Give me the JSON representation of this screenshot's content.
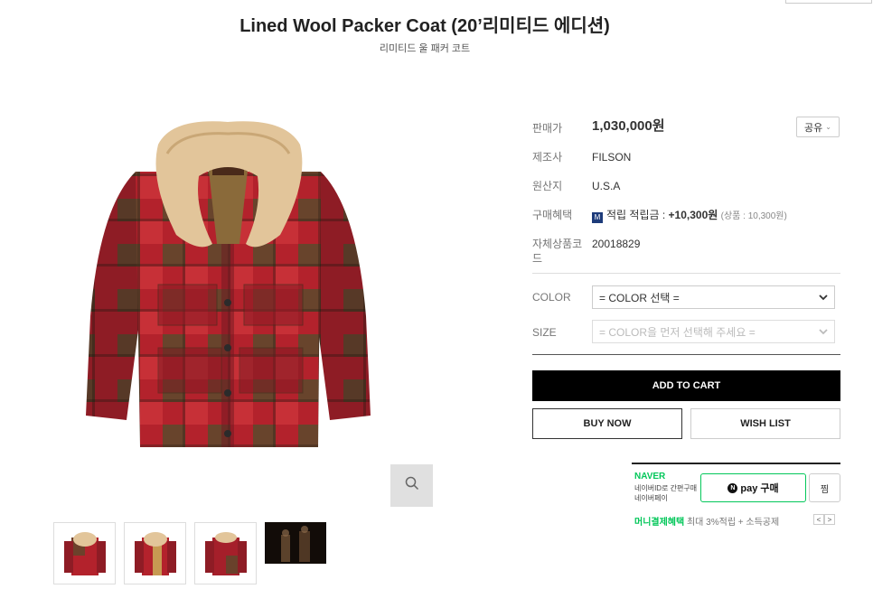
{
  "product": {
    "title": "Lined Wool Packer Coat (20’리미티드 에디션)",
    "subtitle": "리미티드 울 패커 코트"
  },
  "info": {
    "price_label": "판매가",
    "price_value": "1,030,000원",
    "share_label": "공유",
    "maker_label": "제조사",
    "maker_value": "FILSON",
    "origin_label": "원산지",
    "origin_value": "U.S.A",
    "benefit_label": "구매혜택",
    "benefit_badge": "M",
    "benefit_text": "적립 적립금 :",
    "benefit_amount": "+10,300원",
    "benefit_detail": "(상품 : 10,300원)",
    "code_label": "자체상품코드",
    "code_value": "20018829"
  },
  "options": {
    "color_label": "COLOR",
    "color_value": "= COLOR 선택 =",
    "size_label": "SIZE",
    "size_value": "= COLOR을 먼저 선택해 주세요 ="
  },
  "buttons": {
    "add_to_cart": "ADD TO CART",
    "buy_now": "BUY NOW",
    "wish_list": "WISH LIST"
  },
  "naver": {
    "logo": "NAVER",
    "desc_line1": "네이버ID로 간편구매",
    "desc_line2": "네이버페이",
    "pay_label": "pay 구매",
    "pay_n": "N",
    "jjim": "찜",
    "money_title": "머니결제혜택",
    "money_text": "최대 3%적립 + 소득공제",
    "prev": "<",
    "next": ">"
  },
  "colors": {
    "accent": "#000000",
    "naver_green": "#03c75a",
    "plaid_red": "#b3222c",
    "plaid_olive": "#4a4028",
    "collar": "#e2c59a"
  }
}
